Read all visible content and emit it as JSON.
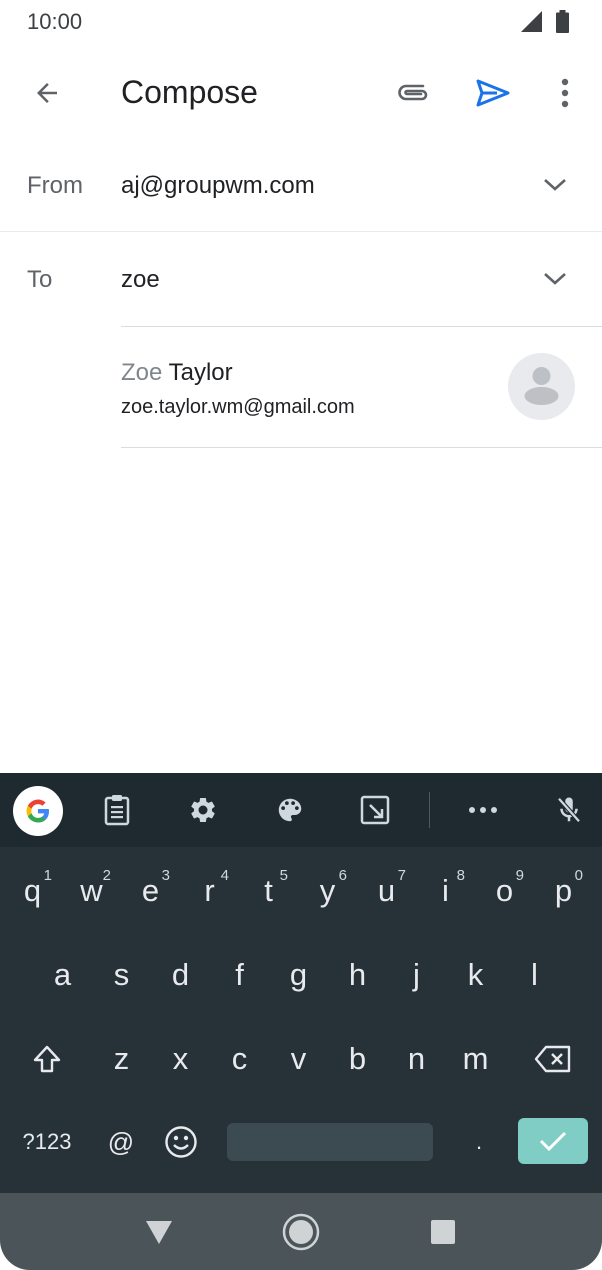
{
  "status_bar": {
    "time": "10:00"
  },
  "app_bar": {
    "title": "Compose"
  },
  "form": {
    "from_label": "From",
    "from_value": "aj@groupwm.com",
    "to_label": "To",
    "to_value": "zoe"
  },
  "suggestion": {
    "name_match": "Zoe",
    "name_rest": " Taylor",
    "email": "zoe.taylor.wm@gmail.com"
  },
  "keyboard": {
    "row1": [
      {
        "k": "q",
        "h": "1"
      },
      {
        "k": "w",
        "h": "2"
      },
      {
        "k": "e",
        "h": "3"
      },
      {
        "k": "r",
        "h": "4"
      },
      {
        "k": "t",
        "h": "5"
      },
      {
        "k": "y",
        "h": "6"
      },
      {
        "k": "u",
        "h": "7"
      },
      {
        "k": "i",
        "h": "8"
      },
      {
        "k": "o",
        "h": "9"
      },
      {
        "k": "p",
        "h": "0"
      }
    ],
    "row2": [
      "a",
      "s",
      "d",
      "f",
      "g",
      "h",
      "j",
      "k",
      "l"
    ],
    "row3": [
      "z",
      "x",
      "c",
      "v",
      "b",
      "n",
      "m"
    ],
    "symbols_label": "?123",
    "at_label": "@",
    "period_label": "."
  },
  "colors": {
    "accent_blue": "#1a73e8",
    "keyboard_bg": "#263238",
    "enter_key": "#7fcdc4"
  }
}
